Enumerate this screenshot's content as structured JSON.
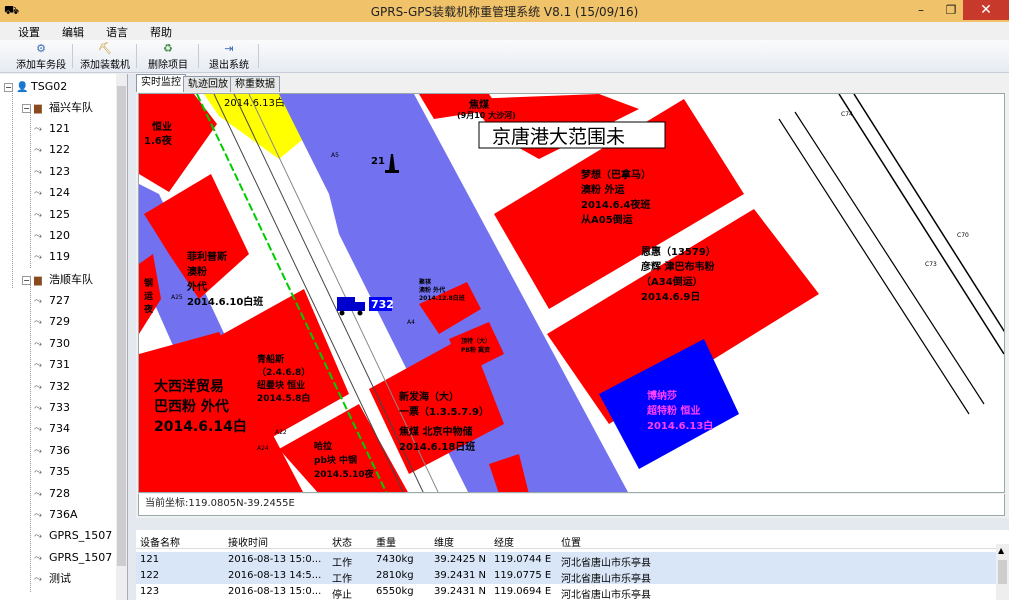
{
  "window": {
    "title": "GPRS-GPS装载机称重管理系统 V8.1 (15/09/16)",
    "minimize": "–",
    "restore": "❐",
    "close": "✕"
  },
  "menu": [
    "设置",
    "编辑",
    "语言",
    "帮助"
  ],
  "toolbar": [
    {
      "label": "添加车务段",
      "icon": "add-depot-icon"
    },
    {
      "label": "添加装载机",
      "icon": "add-loader-icon"
    },
    {
      "label": "删除项目",
      "icon": "delete-icon"
    },
    {
      "label": "退出系统",
      "icon": "exit-icon"
    }
  ],
  "tree": {
    "root": "TSG02",
    "groups": [
      {
        "name": "福兴车队",
        "items": [
          "121",
          "122",
          "123",
          "124",
          "125",
          "120",
          "119"
        ]
      },
      {
        "name": "浩顺车队",
        "items": [
          "727",
          "729",
          "730",
          "731",
          "732",
          "733",
          "734",
          "736",
          "735",
          "728",
          "736A",
          "GPRS_1507",
          "GPRS_1507",
          "测试"
        ]
      }
    ]
  },
  "tabs": [
    "实时监控",
    "轨迹回放",
    "称重数据"
  ],
  "map": {
    "overlay_title": "京唐港大范围未",
    "vehicle_label": "732",
    "marker_label": "21",
    "road_labels": {
      "a5": "A5",
      "a4": "A4",
      "a25": "A25",
      "a24": "A24",
      "a22": "A22",
      "c74": "C74",
      "c70": "C70",
      "c73": "C73"
    },
    "lots": {
      "yellow_date": "2014.6.13白",
      "top_coal": "焦煤",
      "top_coal_sub": "(9月10 大沙河)",
      "mengxiang": [
        "梦想（巴拿马）",
        "澳粉  外运",
        "2014.6.4夜班",
        "从A05倒运"
      ],
      "enhui": [
        "恩惠（13579）",
        "彦辉  津巴布韦粉",
        "（A34倒运）",
        "2014.6.9日"
      ],
      "feili": [
        "菲利普斯",
        "澳粉",
        "外代",
        "2014.6.10白班"
      ],
      "dexi": [
        "大西洋贸易",
        "巴西粉  外代",
        "2014.6.14白"
      ],
      "qinghai": [
        "青船斯",
        "（2.4.6.8）",
        "纽曼块  恒业",
        "2014.5.8白"
      ],
      "xinfa": [
        "新发海（大）",
        "一票（1.3.5.7.9）",
        "焦煤  北京中物储",
        "2014.6.18日班"
      ],
      "hadao": [
        "哈拉",
        "pb块  中钢",
        "2014.5.10夜"
      ],
      "small1": [
        "聚祺",
        "澳粉  外代",
        "2014.12.8白班"
      ],
      "small2": [
        "顶特（大）",
        "PB粉  冀资"
      ],
      "left_top": [
        "恒业",
        "1.6夜"
      ],
      "left_mid": [
        "钢",
        "运",
        "夜"
      ],
      "blue_lot": [
        "博纳莎",
        "超特粉  恒业",
        "2014.6.13白"
      ]
    }
  },
  "coordinate": "当前坐标:119.0805N-39.2455E",
  "table": {
    "columns": [
      "设备名称",
      "接收时间",
      "状态",
      "重量",
      "维度",
      "经度",
      "位置"
    ],
    "rows": [
      [
        "121",
        "2016-08-13 15:0...",
        "工作",
        "7430kg",
        "39.2425 N",
        "119.0744 E",
        "河北省唐山市乐亭县"
      ],
      [
        "122",
        "2016-08-13 14:5...",
        "工作",
        "2810kg",
        "39.2431 N",
        "119.0775 E",
        "河北省唐山市乐亭县"
      ],
      [
        "123",
        "2016-08-13 15:0...",
        "停止",
        "6550kg",
        "39.2431 N",
        "119.0694 E",
        "河北省唐山市乐亭县"
      ]
    ]
  },
  "colors": {
    "lot": "#ff0000",
    "road": "#7272f0",
    "yellow": "#ffff00",
    "blue_lot": "#0000ff"
  }
}
